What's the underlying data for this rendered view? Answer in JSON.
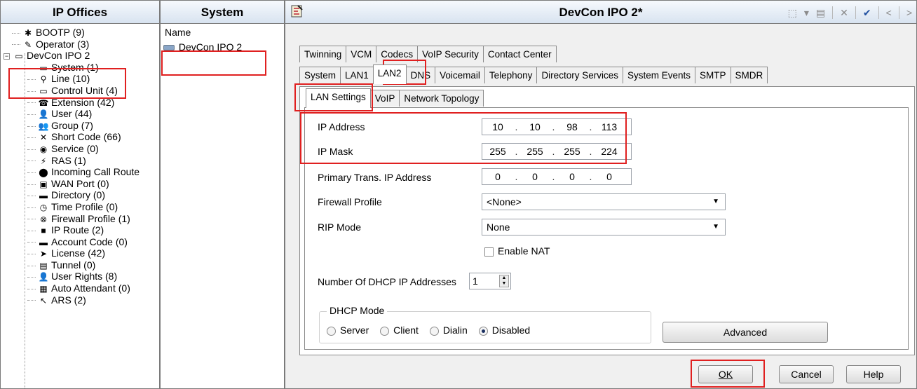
{
  "tree_pane": {
    "header": "IP Offices",
    "items": [
      {
        "label": "BOOTP (9)",
        "icon": "bootp-icon",
        "glyph": "✱"
      },
      {
        "label": "Operator (3)",
        "icon": "operator-icon",
        "glyph": "✎"
      },
      {
        "label": "DevCon IPO 2",
        "icon": "system-unit-icon",
        "glyph": "▭"
      },
      {
        "label": "System (1)",
        "icon": "system-icon",
        "glyph": "▭"
      },
      {
        "label": "Line (10)",
        "icon": "line-icon",
        "glyph": "⚲"
      },
      {
        "label": "Control Unit (4)",
        "icon": "control-unit-icon",
        "glyph": "▭"
      },
      {
        "label": "Extension (42)",
        "icon": "extension-icon",
        "glyph": "☎"
      },
      {
        "label": "User (44)",
        "icon": "user-icon",
        "glyph": "👤"
      },
      {
        "label": "Group (7)",
        "icon": "group-icon",
        "glyph": "👥"
      },
      {
        "label": "Short Code (66)",
        "icon": "short-code-icon",
        "glyph": "✕"
      },
      {
        "label": "Service (0)",
        "icon": "service-icon",
        "glyph": "◉"
      },
      {
        "label": "RAS (1)",
        "icon": "ras-icon",
        "glyph": "⚡"
      },
      {
        "label": "Incoming Call Route",
        "icon": "incoming-call-route-icon",
        "glyph": "⬤"
      },
      {
        "label": "WAN Port (0)",
        "icon": "wan-port-icon",
        "glyph": "▣"
      },
      {
        "label": "Directory (0)",
        "icon": "directory-icon",
        "glyph": "▬"
      },
      {
        "label": "Time Profile (0)",
        "icon": "time-profile-icon",
        "glyph": "◷"
      },
      {
        "label": "Firewall Profile (1)",
        "icon": "firewall-profile-icon",
        "glyph": "⊗"
      },
      {
        "label": "IP Route (2)",
        "icon": "ip-route-icon",
        "glyph": "■"
      },
      {
        "label": "Account Code (0)",
        "icon": "account-code-icon",
        "glyph": "▬"
      },
      {
        "label": "License (42)",
        "icon": "license-icon",
        "glyph": "➤"
      },
      {
        "label": "Tunnel (0)",
        "icon": "tunnel-icon",
        "glyph": "▤"
      },
      {
        "label": "User Rights (8)",
        "icon": "user-rights-icon",
        "glyph": "👤"
      },
      {
        "label": "Auto Attendant (0)",
        "icon": "auto-attendant-icon",
        "glyph": "▦"
      },
      {
        "label": "ARS (2)",
        "icon": "ars-icon",
        "glyph": "↖"
      }
    ]
  },
  "list_pane": {
    "header": "System",
    "column": "Name",
    "item": "DevCon IPO 2"
  },
  "main": {
    "title": "DevCon IPO 2*",
    "toolbar": {
      "new": "⬚",
      "save_menu": "▾",
      "save": "▤",
      "delete": "✕",
      "validate": "✔",
      "prev": "<",
      "next": ">"
    },
    "tabs_row1": [
      "Twinning",
      "VCM",
      "Codecs",
      "VoIP Security",
      "Contact Center"
    ],
    "tabs_row2": [
      "System",
      "LAN1",
      "LAN2",
      "DNS",
      "Voicemail",
      "Telephony",
      "Directory Services",
      "System Events",
      "SMTP",
      "SMDR"
    ],
    "active_tab": "LAN2",
    "subtabs": [
      "LAN Settings",
      "VoIP",
      "Network Topology"
    ],
    "active_subtab": "LAN Settings",
    "fields": {
      "ip_address": {
        "label": "IP Address",
        "octets": [
          "10",
          "10",
          "98",
          "113"
        ]
      },
      "ip_mask": {
        "label": "IP Mask",
        "octets": [
          "255",
          "255",
          "255",
          "224"
        ]
      },
      "primary_trans": {
        "label": "Primary Trans. IP Address",
        "octets": [
          "0",
          "0",
          "0",
          "0"
        ]
      },
      "firewall_profile": {
        "label": "Firewall Profile",
        "value": "<None>"
      },
      "rip_mode": {
        "label": "RIP Mode",
        "value": "None"
      },
      "enable_nat": {
        "label": "Enable NAT",
        "checked": false
      },
      "dhcp_count": {
        "label": "Number Of DHCP IP Addresses",
        "value": "1"
      },
      "dhcp_mode": {
        "legend": "DHCP Mode",
        "options": [
          "Server",
          "Client",
          "Dialin",
          "Disabled"
        ],
        "selected": "Disabled"
      }
    },
    "buttons": {
      "advanced": "Advanced",
      "ok": "OK",
      "cancel": "Cancel",
      "help": "Help"
    }
  },
  "colors": {
    "highlight": "#e02020",
    "header_gradient_top": "#f6f9fd",
    "header_gradient_bottom": "#d8e3f0"
  }
}
